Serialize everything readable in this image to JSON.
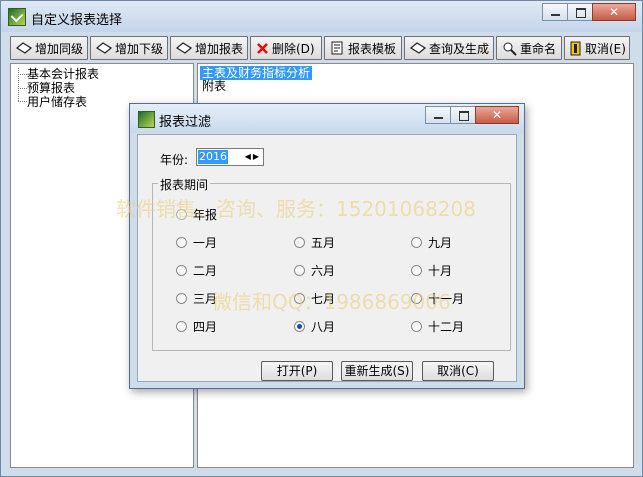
{
  "window": {
    "title": "自定义报表选择"
  },
  "toolbar": [
    {
      "name": "add-sibling-button",
      "icon": "diamond-icon",
      "label": "增加同级"
    },
    {
      "name": "add-child-button",
      "icon": "diamond-icon",
      "label": "增加下级"
    },
    {
      "name": "add-report-button",
      "icon": "diamond-icon",
      "label": "增加报表"
    },
    {
      "name": "delete-button",
      "icon": "red-x-icon",
      "label": "删除(D)"
    },
    {
      "name": "report-template-button",
      "icon": "template-icon",
      "label": "报表模板"
    },
    {
      "name": "query-generate-button",
      "icon": "diamond-icon",
      "label": "查询及生成"
    },
    {
      "name": "rename-button",
      "icon": "rename-icon",
      "label": "重命名"
    },
    {
      "name": "cancel-button",
      "icon": "exit-icon",
      "label": "取消(E)"
    }
  ],
  "tree": [
    "基本会计报表",
    "预算报表",
    "用户储存表"
  ],
  "list": {
    "items": [
      "主表及财务指标分析",
      "附表"
    ],
    "selected_index": 0
  },
  "dialog": {
    "title": "报表过滤",
    "year_label": "年份:",
    "year_value": "2016",
    "group_label": "报表期间",
    "options": {
      "annual": "年报",
      "jan": "一月",
      "feb": "二月",
      "mar": "三月",
      "apr": "四月",
      "may": "五月",
      "jun": "六月",
      "jul": "七月",
      "aug": "八月",
      "sep": "九月",
      "oct": "十月",
      "nov": "十一月",
      "dec": "十二月"
    },
    "selected": "八月",
    "buttons": {
      "open": "打开(P)",
      "regen": "重新生成(S)",
      "cancel": "取消(C)"
    }
  },
  "watermark": {
    "line1": "软件销售、咨询、服务：15201068208",
    "line2": "微信和QQ：1986869006"
  },
  "colors": {
    "selection": "#3399ff",
    "frame": "#cfdcea"
  }
}
